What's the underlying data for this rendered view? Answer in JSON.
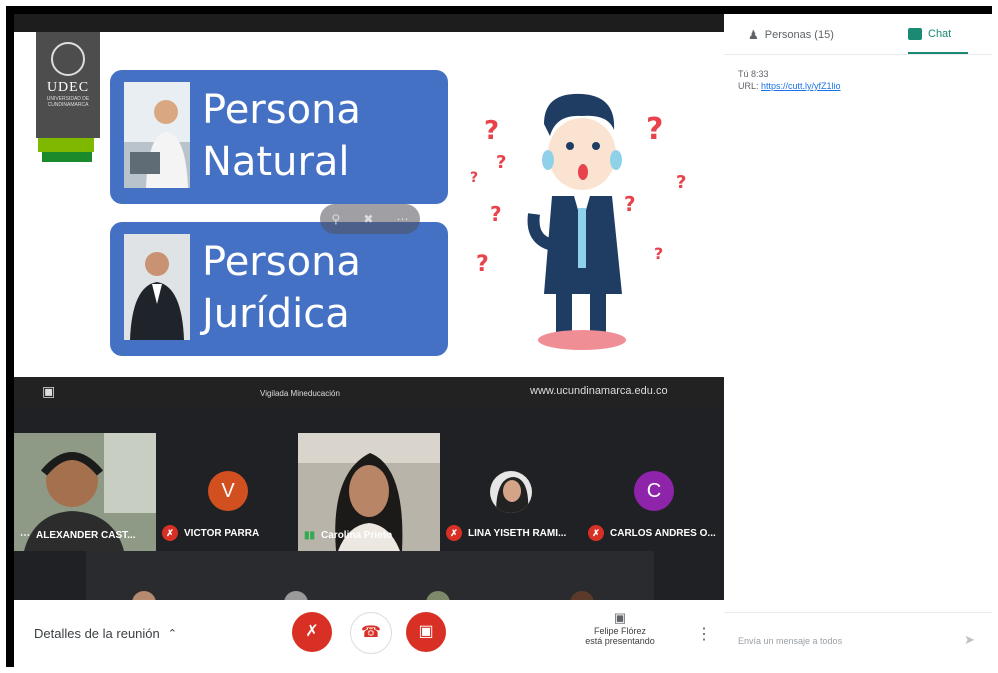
{
  "slide": {
    "logo_name": "UDEC",
    "logo_sub": "UNIVERSIDAD DE CUNDINAMARCA",
    "card1_line1": "Persona",
    "card1_line2": "Natural",
    "card2_line1": "Persona",
    "card2_line2": "Jurídica",
    "footer_center": "Vigilada Mineducación",
    "footer_url": "www.ucundinamarca.edu.co"
  },
  "participants": [
    {
      "name": "ALEXANDER CAST...",
      "type": "video",
      "muted": false
    },
    {
      "name": "VICTOR PARRA",
      "type": "avatar",
      "initial": "V",
      "color": "#d2501f",
      "muted": true
    },
    {
      "name": "Carolina Prieto",
      "type": "video",
      "muted": false
    },
    {
      "name": "LINA YISETH RAMI...",
      "type": "photo",
      "muted": true
    },
    {
      "name": "CARLOS ANDRES O...",
      "type": "avatar",
      "initial": "C",
      "color": "#8e24aa",
      "muted": true
    }
  ],
  "bottombar": {
    "meeting_details": "Detalles de la reunión",
    "presenter_line1": "Felipe Flórez",
    "presenter_line2": "está presentando"
  },
  "panel": {
    "people_tab": "Personas (15)",
    "chat_tab": "Chat",
    "msg_sender": "Tú",
    "msg_time": "8:33",
    "msg_prefix": "URL:",
    "msg_link": "https://cutt.ly/yfZ1lio",
    "input_placeholder": "Envía un mensaje a todos"
  },
  "colors": {
    "accent": "#1a8a73",
    "danger": "#d93025",
    "card": "#4471c3"
  }
}
